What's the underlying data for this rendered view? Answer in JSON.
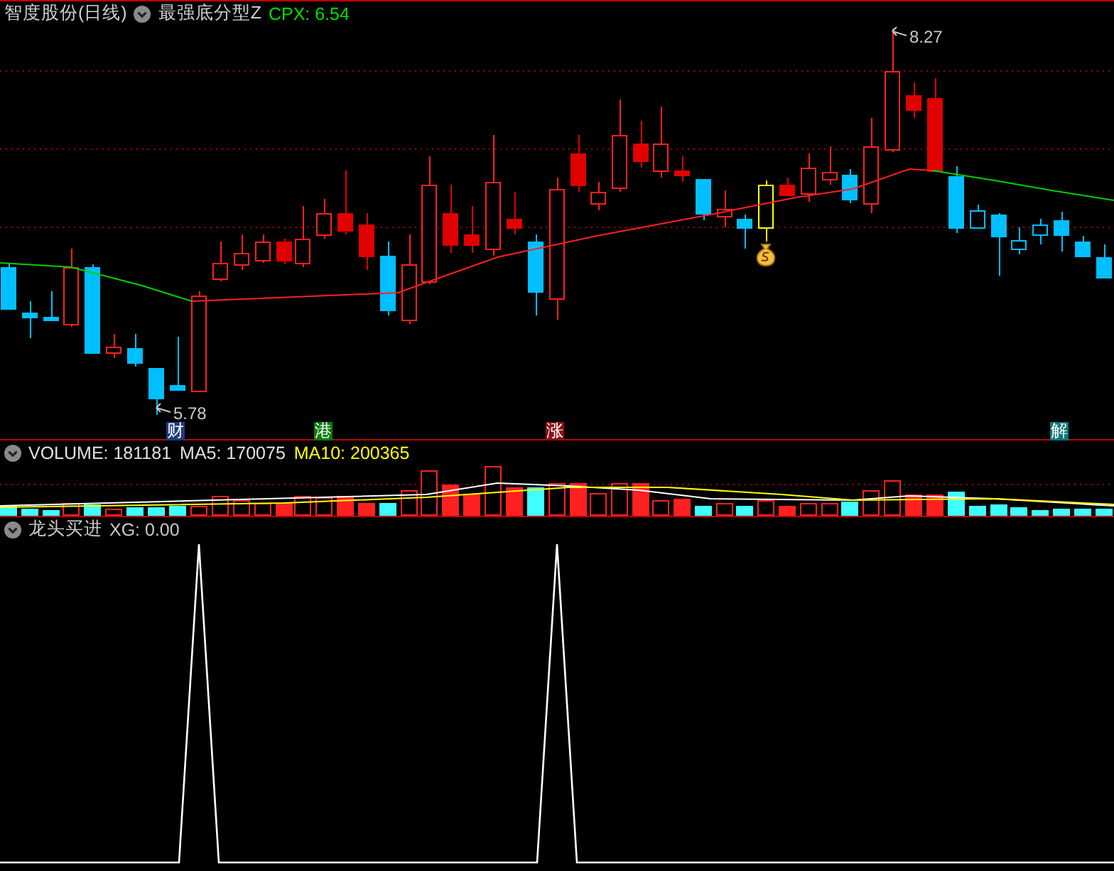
{
  "main_panel": {
    "title": "智度股份(日线)",
    "indicator_name": "最强底分型Z",
    "readouts": [
      {
        "label": "CPX: 6.54",
        "color": "#00e000"
      }
    ],
    "price_labels": [
      {
        "text": "8.27"
      },
      {
        "text": "5.78"
      }
    ],
    "event_markers": [
      {
        "text": "财",
        "color": "#1e3c80"
      },
      {
        "text": "港",
        "color": "#0c7a0c"
      },
      {
        "text": "涨",
        "color": "#8a1212"
      },
      {
        "text": "解",
        "color": "#0c7878"
      }
    ]
  },
  "volume_panel": {
    "readouts": [
      {
        "label": "VOLUME: 181181",
        "color": "#e0e0e0"
      },
      {
        "label": "MA5: 170075",
        "color": "#e0e0e0"
      },
      {
        "label": "MA10: 200365",
        "color": "#ffff00"
      }
    ]
  },
  "indicator_panel": {
    "title": "龙头买进",
    "readouts": [
      {
        "label": "XG: 0.00",
        "color": "#c8c8c8"
      }
    ]
  }
}
